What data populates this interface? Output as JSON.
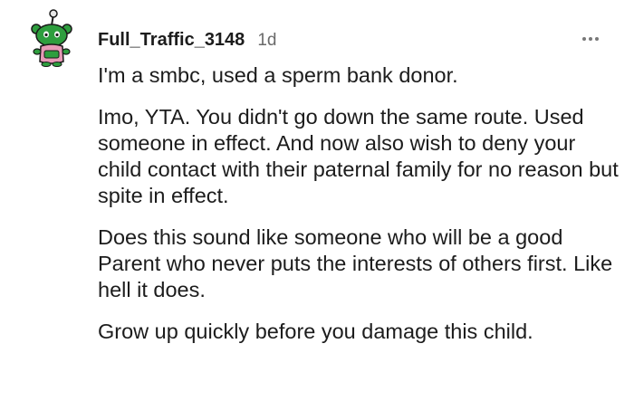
{
  "comment": {
    "author": "Full_Traffic_3148",
    "age": "1d",
    "paragraphs": [
      "I'm a smbc, used a sperm bank donor.",
      "Imo, YTA. You didn't go down the same route. Used someone in effect. And now also wish to deny your child contact with their paternal family for no reason but spite in effect.",
      "Does this sound like someone who will be a good Parent who never puts the interests of others first. Like hell it does.",
      "Grow up quickly before you damage this child."
    ]
  },
  "icons": {
    "avatar": "snoo-avatar-icon",
    "more": "more-options-icon"
  },
  "colors": {
    "avatar_green": "#2e9e3e",
    "avatar_pink": "#e79ab7",
    "meta_gray": "#6a6a6a"
  }
}
